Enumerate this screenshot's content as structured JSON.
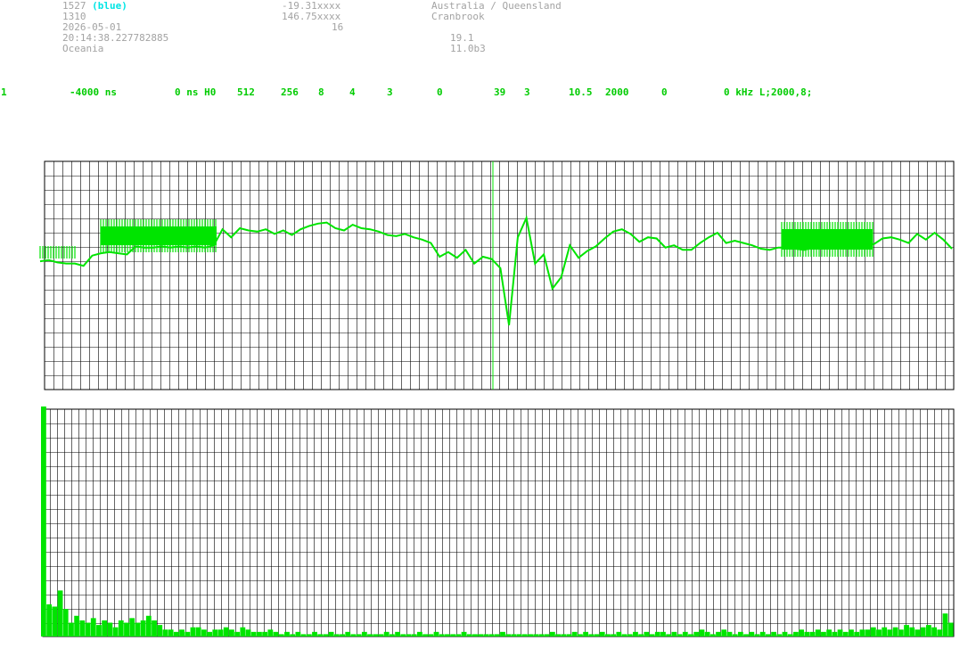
{
  "header": {
    "station_id": "1527",
    "station_color": "(blue)",
    "code": "1310",
    "date": "2026-05-01",
    "time": "20:14:38.227782885",
    "region": "Oceania",
    "latitude": "-19.31xxxx",
    "longitude": "146.75xxxx",
    "channel": "16",
    "location": "Australia / Queensland",
    "place": "Cranbrook",
    "value1": "19.1",
    "value2": "11.0b3"
  },
  "params": [
    "1",
    "-4000 ns",
    "0 ns H0",
    "512",
    "256",
    "8",
    "4",
    "3",
    "0",
    "39",
    "3",
    "10.5",
    "2000",
    "0",
    "0 kHz L;2000,8;"
  ],
  "colors": {
    "trace": "#00e400",
    "grid": "#000000",
    "text": "#a3a3a3",
    "accent": "#00e5e5",
    "params": "#00cc00"
  },
  "chart_data": [
    {
      "type": "line",
      "title": "",
      "xlabel": "",
      "ylabel": "",
      "grid": true,
      "x_range": [
        0,
        1
      ],
      "y_range": [
        -1,
        1
      ],
      "y": [
        0.14,
        0.15,
        0.13,
        0.12,
        0.12,
        0.1,
        0.19,
        0.21,
        0.22,
        0.21,
        0.2,
        0.27,
        0.26,
        0.26,
        0.27,
        0.26,
        0.27,
        0.26,
        0.27,
        0.26,
        0.28,
        0.42,
        0.35,
        0.43,
        0.41,
        0.4,
        0.42,
        0.38,
        0.41,
        0.37,
        0.42,
        0.45,
        0.47,
        0.48,
        0.43,
        0.41,
        0.46,
        0.43,
        0.42,
        0.4,
        0.37,
        0.36,
        0.38,
        0.35,
        0.33,
        0.3,
        0.18,
        0.22,
        0.17,
        0.24,
        0.12,
        0.18,
        0.16,
        0.08,
        -0.42,
        0.35,
        0.52,
        0.12,
        0.2,
        -0.1,
        0.0,
        0.28,
        0.17,
        0.23,
        0.27,
        0.34,
        0.4,
        0.42,
        0.38,
        0.31,
        0.35,
        0.34,
        0.26,
        0.28,
        0.24,
        0.24,
        0.3,
        0.35,
        0.39,
        0.3,
        0.32,
        0.3,
        0.28,
        0.25,
        0.24,
        0.26,
        0.26,
        0.25,
        0.24,
        0.26,
        0.26,
        0.25,
        0.26,
        0.25,
        0.3,
        0.3,
        0.29,
        0.34,
        0.35,
        0.33,
        0.3,
        0.38,
        0.33,
        0.39,
        0.33,
        0.25
      ]
    },
    {
      "type": "bar",
      "title": "",
      "grid": true,
      "y_range": [
        0,
        1
      ],
      "values": [
        1.0,
        0.14,
        0.13,
        0.2,
        0.12,
        0.06,
        0.09,
        0.07,
        0.06,
        0.08,
        0.05,
        0.07,
        0.06,
        0.04,
        0.07,
        0.06,
        0.08,
        0.06,
        0.07,
        0.09,
        0.07,
        0.05,
        0.03,
        0.03,
        0.02,
        0.03,
        0.02,
        0.04,
        0.04,
        0.03,
        0.02,
        0.03,
        0.03,
        0.04,
        0.03,
        0.02,
        0.04,
        0.03,
        0.02,
        0.02,
        0.02,
        0.03,
        0.02,
        0.01,
        0.02,
        0.01,
        0.02,
        0.01,
        0.01,
        0.02,
        0.01,
        0.01,
        0.02,
        0.01,
        0.01,
        0.02,
        0.01,
        0.01,
        0.02,
        0.01,
        0.01,
        0.01,
        0.02,
        0.01,
        0.02,
        0.01,
        0.01,
        0.01,
        0.02,
        0.01,
        0.01,
        0.02,
        0.01,
        0.01,
        0.01,
        0.01,
        0.02,
        0.01,
        0.01,
        0.01,
        0.01,
        0.01,
        0.01,
        0.02,
        0.01,
        0.01,
        0.01,
        0.01,
        0.01,
        0.01,
        0.01,
        0.01,
        0.02,
        0.01,
        0.01,
        0.01,
        0.02,
        0.01,
        0.02,
        0.01,
        0.01,
        0.02,
        0.01,
        0.01,
        0.02,
        0.01,
        0.01,
        0.02,
        0.01,
        0.02,
        0.01,
        0.02,
        0.02,
        0.01,
        0.02,
        0.01,
        0.02,
        0.01,
        0.02,
        0.03,
        0.02,
        0.01,
        0.02,
        0.03,
        0.02,
        0.01,
        0.02,
        0.01,
        0.02,
        0.01,
        0.02,
        0.01,
        0.02,
        0.01,
        0.02,
        0.01,
        0.02,
        0.03,
        0.02,
        0.02,
        0.03,
        0.02,
        0.03,
        0.02,
        0.03,
        0.02,
        0.03,
        0.02,
        0.03,
        0.03,
        0.04,
        0.03,
        0.04,
        0.03,
        0.04,
        0.03,
        0.05,
        0.04,
        0.03,
        0.04,
        0.05,
        0.04,
        0.03,
        0.1,
        0.06
      ]
    }
  ]
}
